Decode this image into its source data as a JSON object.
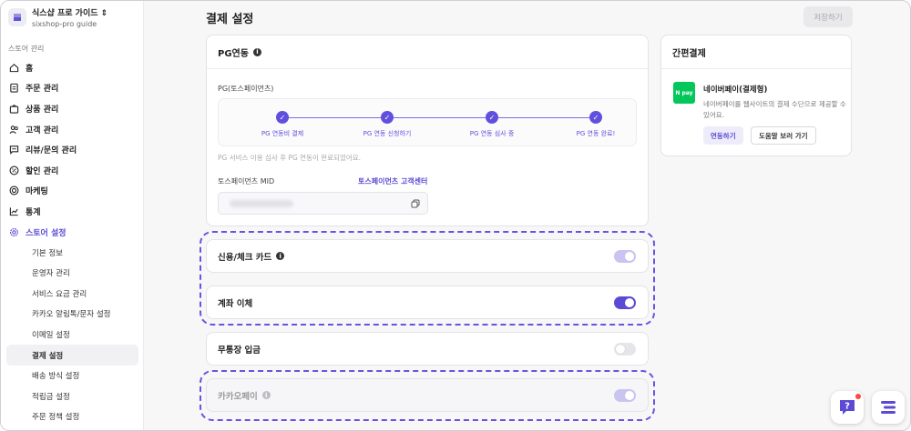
{
  "store": {
    "name": "식스샵 프로 가이드",
    "domain": "sixshop-pro guide"
  },
  "sidebar": {
    "section_label": "스토어 관리",
    "items": [
      {
        "label": "홈",
        "icon": "home-icon"
      },
      {
        "label": "주문 관리",
        "icon": "clipboard-icon"
      },
      {
        "label": "상품 관리",
        "icon": "bag-icon"
      },
      {
        "label": "고객 관리",
        "icon": "users-icon"
      },
      {
        "label": "리뷰/문의 관리",
        "icon": "chat-icon"
      },
      {
        "label": "할인 관리",
        "icon": "discount-icon"
      },
      {
        "label": "마케팅",
        "icon": "target-icon"
      },
      {
        "label": "통계",
        "icon": "chart-icon"
      },
      {
        "label": "스토어 설정",
        "icon": "gear-icon",
        "active": true
      }
    ],
    "sub_items": [
      {
        "label": "기본 정보"
      },
      {
        "label": "운영자 관리"
      },
      {
        "label": "서비스 요금 관리"
      },
      {
        "label": "카카오 알림톡/문자 설정"
      },
      {
        "label": "이메일 설정"
      },
      {
        "label": "결제 설정",
        "active": true
      },
      {
        "label": "배송 방식 설정"
      },
      {
        "label": "적립금 설정"
      },
      {
        "label": "주문 정책 설정"
      }
    ]
  },
  "header": {
    "title": "결제 설정",
    "save_label": "저장하기"
  },
  "pg": {
    "title": "PG연동",
    "provider_label": "PG(토스페이먼츠)",
    "steps": [
      "PG 연동비 결제",
      "PG 연동 신청하기",
      "PG 연동 심사 중",
      "PG 연동 완료!"
    ],
    "note": "PG 서비스 이용 심사 후 PG 연동이 완료되었어요.",
    "mid_label": "토스페이먼츠 MID",
    "mid_link": "토스페이먼츠 고객센터"
  },
  "payment_methods": [
    {
      "label": "신용/체크 카드",
      "state": "on-disabled",
      "info": true
    },
    {
      "label": "계좌 이체",
      "state": "on"
    },
    {
      "label": "무통장 입금",
      "state": "off"
    },
    {
      "label": "카카오페이",
      "state": "on-disabled",
      "info": true,
      "disabled": true
    }
  ],
  "easy_pay": {
    "title": "간편결제",
    "logo_text": "N pay",
    "name": "네이버페이(결제형)",
    "desc": "네이버페이를 웹사이트의 결제 수단으로 제공할 수 있어요.",
    "connect_label": "연동하기",
    "help_label": "도움말 보러 가기"
  },
  "colors": {
    "accent": "#5b4bd4",
    "highlight": "#6a52e0",
    "naver": "#03c75a"
  }
}
